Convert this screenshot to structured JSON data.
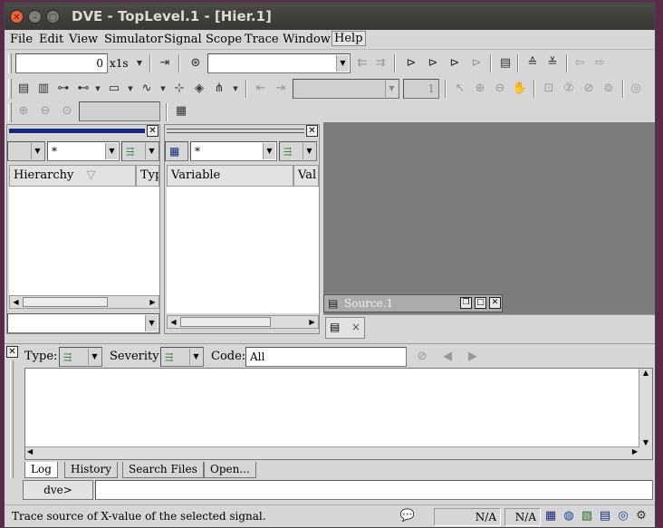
{
  "window": {
    "title": "DVE - TopLevel.1 - [Hier.1]"
  },
  "menu": [
    "File",
    "Edit",
    "View",
    "Simulator",
    "Signal",
    "Scope",
    "Trace",
    "Window",
    "Help"
  ],
  "toolbar": {
    "time_value": "0",
    "time_unit": "x1s",
    "search_value": "",
    "step_value": "1"
  },
  "hierarchy_panel": {
    "filter": "*",
    "col_hierarchy": "Hierarchy",
    "col_type": "Typ"
  },
  "data_panel": {
    "filter": "*",
    "col_variable": "Variable",
    "col_value": "Val"
  },
  "source_window": {
    "title": "Source.1",
    "close_label": "×"
  },
  "console": {
    "type_label": "Type:",
    "severity_label": "Severity:",
    "code_label": "Code:",
    "code_value": "All",
    "tabs": [
      "Log",
      "History",
      "Search Files",
      "Open..."
    ],
    "prompt": "dve>",
    "command_value": ""
  },
  "status": {
    "message": "Trace source of X-value of the selected signal.",
    "cell1": "N/A",
    "cell2": "N/A"
  },
  "colors": {
    "accent_active_panel": "#1a2a80",
    "title_close": "#f0643a",
    "workspace_gray": "#7c7c7c"
  },
  "icons": {
    "step": "step-icon",
    "binoculars": "binoculars-icon",
    "find_prev": "find-previous-icon",
    "find_next": "find-next-icon",
    "back": "back-arrow-icon",
    "forward": "forward-arrow-icon",
    "pointer": "pointer-icon",
    "zoom_in": "zoom-in-icon",
    "zoom_out": "zoom-out-icon",
    "pan": "hand-pan-icon"
  }
}
